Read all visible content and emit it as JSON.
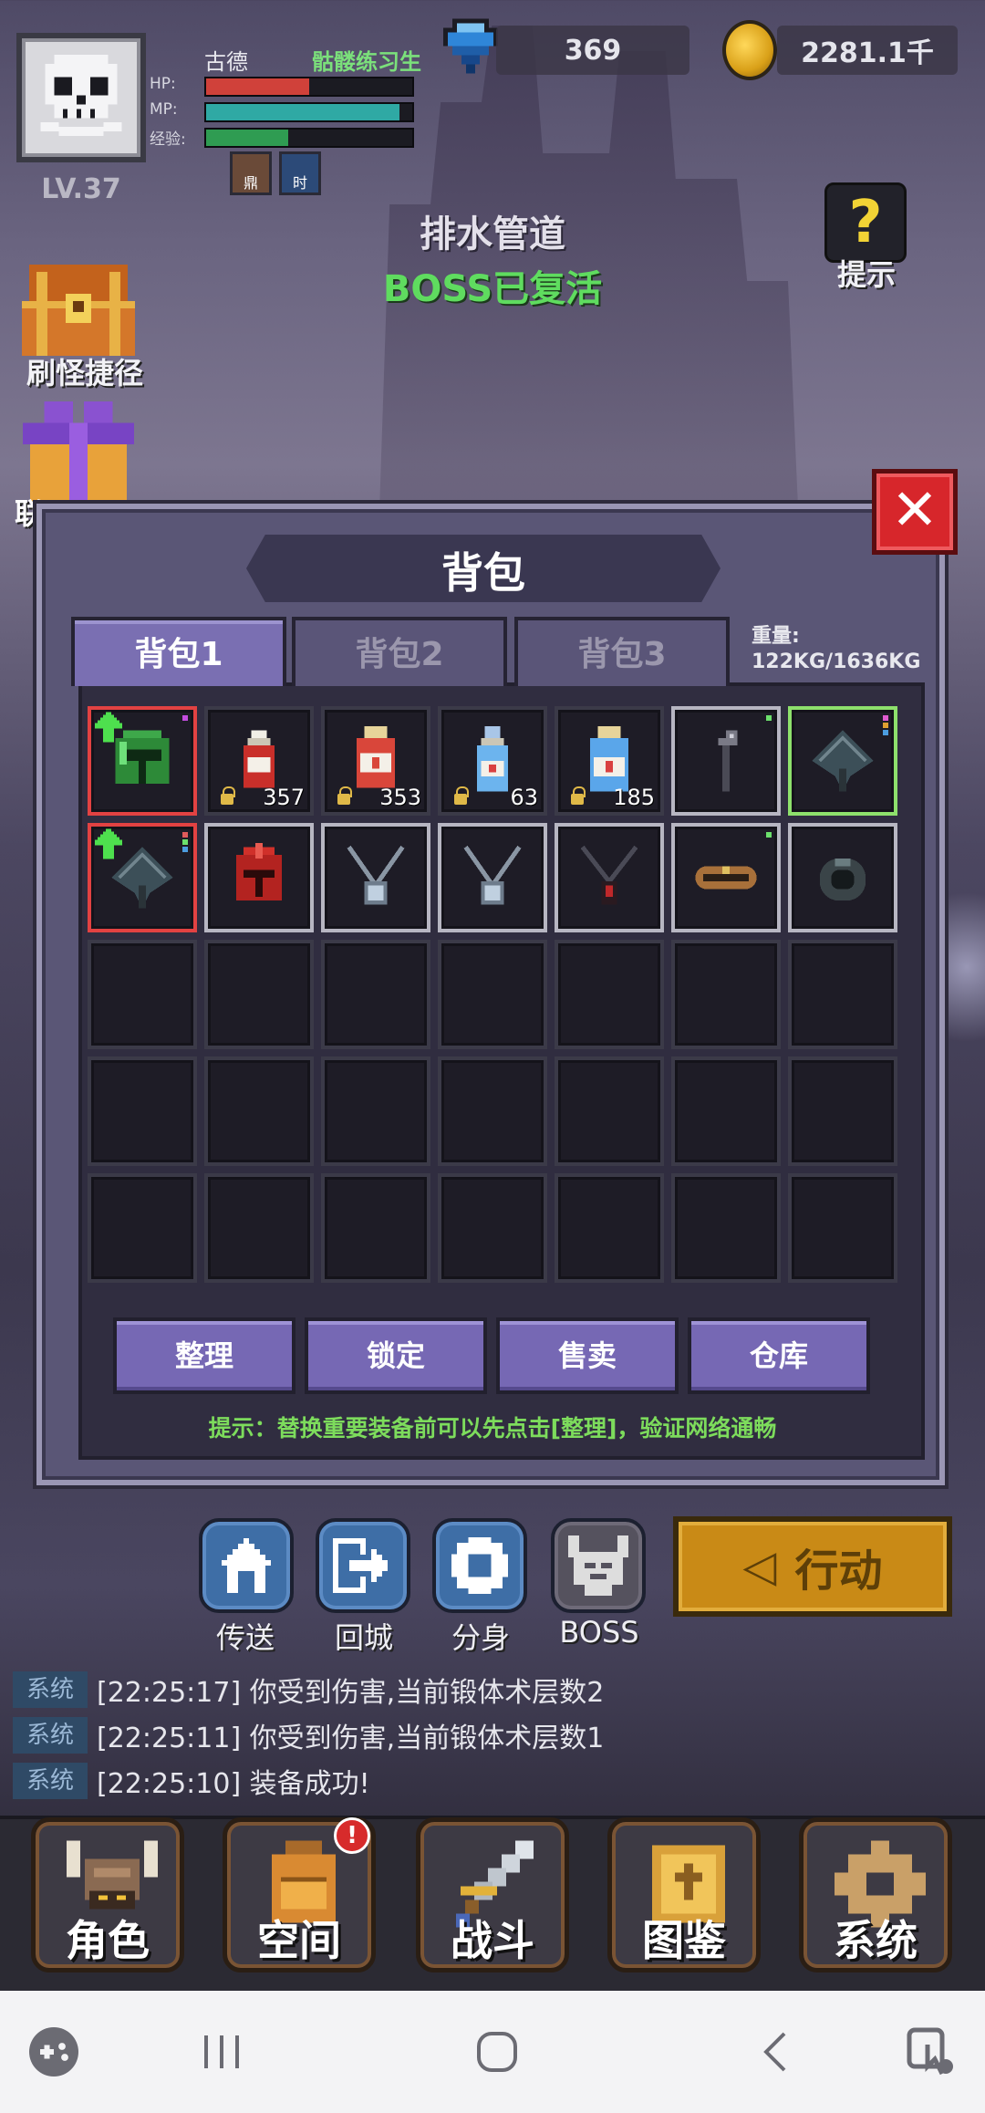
{
  "player": {
    "name": "古德",
    "title": "骷髅练习生",
    "level": "LV.37",
    "hp_label": "HP:",
    "mp_label": "MP:",
    "exp_label": "经验:",
    "hp_fraction": 0.5,
    "mp_fraction": 0.94,
    "exp_fraction": 0.4,
    "buffs": [
      "鼎",
      "时"
    ]
  },
  "resources": {
    "gems": "369",
    "gold": "2281.1千"
  },
  "map": {
    "name": "排水管道",
    "boss_status": "BOSS已复活"
  },
  "hint_label": "提示",
  "hint_glyph": "?",
  "side_buttons": {
    "chest_label": "刷怪捷径",
    "gift_label_partial": "联"
  },
  "bag": {
    "title": "背包",
    "tabs": [
      "背包1",
      "背包2",
      "背包3"
    ],
    "active_tab": 0,
    "weight_label": "重量:",
    "weight_value": "122KG/1636KG",
    "slots": [
      {
        "item": "green-helmet",
        "border": "red",
        "upgrade": true,
        "dots": [
          "#c44de0"
        ]
      },
      {
        "item": "red-potion-small",
        "border": "none",
        "locked": true,
        "qty": "357"
      },
      {
        "item": "red-potion-large",
        "border": "none",
        "locked": true,
        "qty": "353"
      },
      {
        "item": "blue-potion-small",
        "border": "none",
        "locked": true,
        "qty": "63"
      },
      {
        "item": "blue-potion-large",
        "border": "none",
        "locked": true,
        "qty": "185"
      },
      {
        "item": "staff",
        "border": "white",
        "dots": [
          "#6ce06c"
        ]
      },
      {
        "item": "fan",
        "border": "green",
        "dots": [
          "#e05bd0",
          "#e0a030",
          "#4c9de0"
        ]
      },
      {
        "item": "fan",
        "border": "red",
        "upgrade": true,
        "dots": [
          "#e05b5b",
          "#6ce06c",
          "#4c9de0"
        ]
      },
      {
        "item": "red-helmet",
        "border": "white"
      },
      {
        "item": "amulet",
        "border": "white"
      },
      {
        "item": "amulet",
        "border": "white"
      },
      {
        "item": "dark-necklace",
        "border": "white"
      },
      {
        "item": "bracelet",
        "border": "white",
        "dots": [
          "#6ce06c"
        ]
      },
      {
        "item": "ring",
        "border": "white"
      },
      {},
      {},
      {},
      {},
      {},
      {},
      {},
      {},
      {},
      {},
      {},
      {},
      {},
      {},
      {},
      {},
      {},
      {},
      {},
      {},
      {}
    ],
    "buttons": [
      "整理",
      "锁定",
      "售卖",
      "仓库"
    ],
    "tip": "提示：替换重要装备前可以先点击[整理]，验证网络通畅"
  },
  "quick_actions": [
    {
      "label": "传送",
      "icon": "home-icon"
    },
    {
      "label": "回城",
      "icon": "exit-icon"
    },
    {
      "label": "分身",
      "icon": "gear-shield-icon"
    },
    {
      "label": "BOSS",
      "icon": "demon-icon"
    }
  ],
  "action_button": {
    "label": "行动",
    "glyph": "◁"
  },
  "log": [
    {
      "tag": "系统",
      "text": "[22:25:17] 你受到伤害,当前锻体术层数2"
    },
    {
      "tag": "系统",
      "text": "[22:25:11] 你受到伤害,当前锻体术层数1"
    },
    {
      "tag": "系统",
      "text": "[22:25:10] 装备成功!"
    }
  ],
  "nav": [
    {
      "label": "角色",
      "icon": "viking-helmet-icon"
    },
    {
      "label": "空间",
      "icon": "backpack-icon",
      "badge": "!"
    },
    {
      "label": "战斗",
      "icon": "sword-icon"
    },
    {
      "label": "图鉴",
      "icon": "book-icon"
    },
    {
      "label": "系统",
      "icon": "gear-icon"
    }
  ],
  "colors": {
    "hp": "#d0413a",
    "mp": "#2fa9a4",
    "exp": "#2f9c52",
    "accent": "#7668b4"
  }
}
